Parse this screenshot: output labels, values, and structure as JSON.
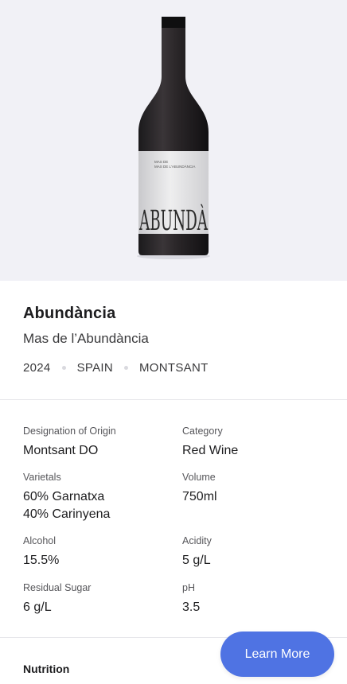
{
  "hero": {
    "bottle_label_small": "MAS DE L'ABUNDÀNCIA",
    "bottle_label_big": "ABUNDÀ"
  },
  "wine": {
    "name": "Abundància",
    "producer": "Mas de l’Abundància",
    "year": "2024",
    "country": "SPAIN",
    "region": "MONTSANT"
  },
  "details": {
    "designation_label": "Designation of Origin",
    "designation_value": "Montsant DO",
    "category_label": "Category",
    "category_value": "Red Wine",
    "varietals_label": "Varietals",
    "varietals_values": [
      "60% Garnatxa",
      "40% Carinyena"
    ],
    "volume_label": "Volume",
    "volume_value": "750ml",
    "alcohol_label": "Alcohol",
    "alcohol_value": "15.5%",
    "acidity_label": "Acidity",
    "acidity_value": "5 g/L",
    "sugar_label": "Residual Sugar",
    "sugar_value": "6 g/L",
    "ph_label": "pH",
    "ph_value": "3.5"
  },
  "nutrition": {
    "title": "Nutrition"
  },
  "actions": {
    "learn_more": "Learn More"
  },
  "colors": {
    "accent": "#4f73e3",
    "hero_bg": "#f1f1f6"
  }
}
